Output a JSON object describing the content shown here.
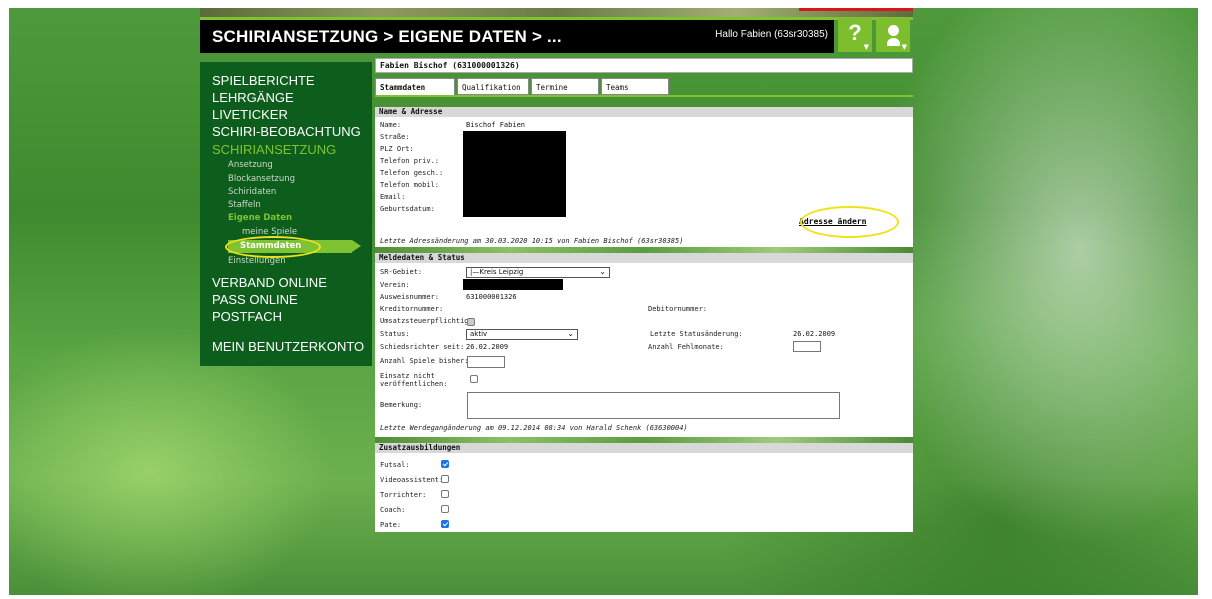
{
  "header": {
    "title": "SCHIRIANSETZUNG > EIGENE DATEN > ...",
    "greeting": "Hallo Fabien (63sr30385)",
    "help_label": "?"
  },
  "sidebar": {
    "main_top": [
      "SPIELBERICHTE",
      "LEHRGÄNGE",
      "LIVETICKER",
      "SCHIRI-BEOBACHTUNG"
    ],
    "active_section": "SCHIRIANSETZUNG",
    "subitems": [
      "Ansetzung",
      "Blockansetzung",
      "Schiridaten",
      "Staffeln"
    ],
    "eigene_daten": "Eigene Daten",
    "meine_spiele": "meine Spiele",
    "stammdaten": "Stammdaten",
    "einstellungen": "Einstellungen",
    "main_bottom": [
      "VERBAND ONLINE",
      "PASS ONLINE",
      "POSTFACH"
    ],
    "account": "MEIN BENUTZERKONTO"
  },
  "person": {
    "name_bar": "Fabien Bischof (631000001326)"
  },
  "tabs": [
    "Stammdaten",
    "Qualifikation",
    "Termine",
    "Teams"
  ],
  "address": {
    "heading": "Name & Adresse",
    "labels": [
      "Name:",
      "Straße:",
      "PLZ Ort:",
      "Telefon priv.:",
      "Telefon gesch.:",
      "Telefon mobil:",
      "Email:",
      "Geburtsdatum:"
    ],
    "name_value": "Bischof Fabien",
    "change_link": "Adresse ändern",
    "footer": "Letzte Adressänderung am 30.03.2020 10:15 von Fabien Bischof (63sr30385)"
  },
  "meldedaten": {
    "heading": "Meldedaten & Status",
    "sr_gebiet_label": "SR-Gebiet:",
    "sr_gebiet_value": "|—Kreis Leipzig",
    "verein_label": "Verein:",
    "ausweis_label": "Ausweisnummer:",
    "ausweis_value": "631000001326",
    "kreditor_label": "Kreditornummer:",
    "debitor_label": "Debitornummer:",
    "umsatz_label": "Umsatzsteuerpflichtig:",
    "status_label": "Status:",
    "status_value": "aktiv",
    "letzte_status_label": "Letzte Statusänderung:",
    "letzte_status_value": "26.02.2009",
    "schiri_seit_label": "Schiedsrichter seit:",
    "schiri_seit_value": "26.02.2009",
    "fehlmonate_label": "Anzahl Fehlmonate:",
    "spiele_label": "Anzahl Spiele bisher:",
    "einsatz_label_1": "Einsatz nicht",
    "einsatz_label_2": "veröffentlichen:",
    "bemerkung_label": "Bemerkung:",
    "footer": "Letzte Werdegangänderung am 09.12.2014 08:34 von Harald Schenk (63630004)"
  },
  "zusatz": {
    "heading": "Zusatzausbildungen",
    "items": [
      {
        "label": "Futsal:",
        "checked": true
      },
      {
        "label": "Videoassistent:",
        "checked": false
      },
      {
        "label": "Torrichter:",
        "checked": false
      },
      {
        "label": "Coach:",
        "checked": false
      },
      {
        "label": "Pate:",
        "checked": true
      }
    ]
  }
}
